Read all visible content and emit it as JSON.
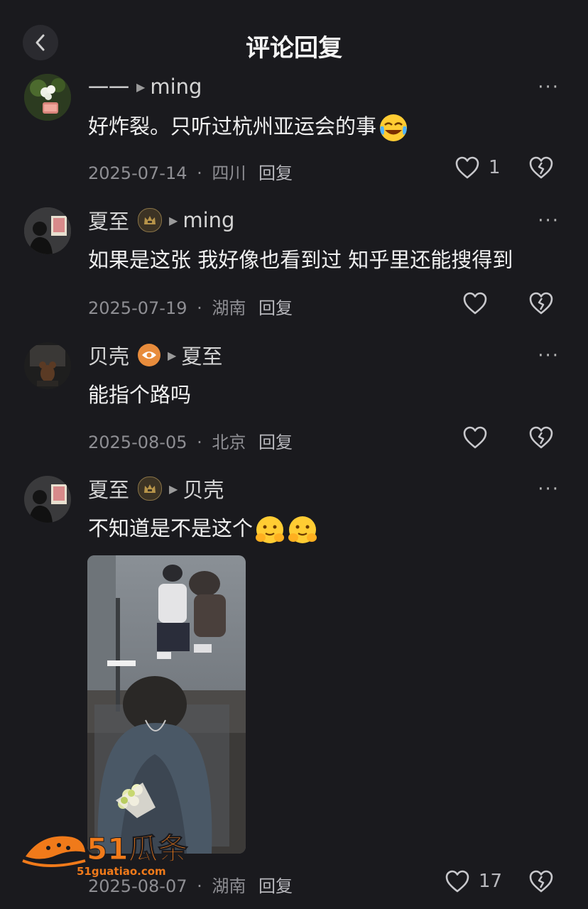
{
  "header": {
    "title": "评论回复"
  },
  "comments": [
    {
      "user": "一一",
      "reply_to": "ming",
      "badge": "",
      "text": "好炸裂。只听过杭州亚运会的事",
      "emoji": [
        "laugh-cry"
      ],
      "date": "2025-07-14",
      "location": "四川",
      "reply": "回复",
      "likes": "1"
    },
    {
      "user": "夏至",
      "reply_to": "ming",
      "badge": "crown",
      "text": "如果是这张  我好像也看到过  知乎里还能搜得到",
      "emoji": [],
      "date": "2025-07-19",
      "location": "湖南",
      "reply": "回复",
      "likes": ""
    },
    {
      "user": "贝壳",
      "reply_to": "夏至",
      "badge": "eye",
      "text": "能指个路吗",
      "emoji": [],
      "date": "2025-08-05",
      "location": "北京",
      "reply": "回复",
      "likes": ""
    },
    {
      "user": "夏至",
      "reply_to": "贝壳",
      "badge": "crown",
      "text": "不知道是不是这个",
      "emoji": [
        "hugging-face",
        "hugging-face"
      ],
      "date": "2025-08-07",
      "location": "湖南",
      "reply": "回复",
      "likes": "17"
    }
  ],
  "meta_separator": "·",
  "more_glyph": "···",
  "watermark": {
    "brand": "51瓜条",
    "url": "51guatiao.com"
  },
  "colors": {
    "background": "#1a1a1e",
    "text": "#f0f0f0",
    "muted": "#8e8e93",
    "watermark": "#f07a1a"
  }
}
